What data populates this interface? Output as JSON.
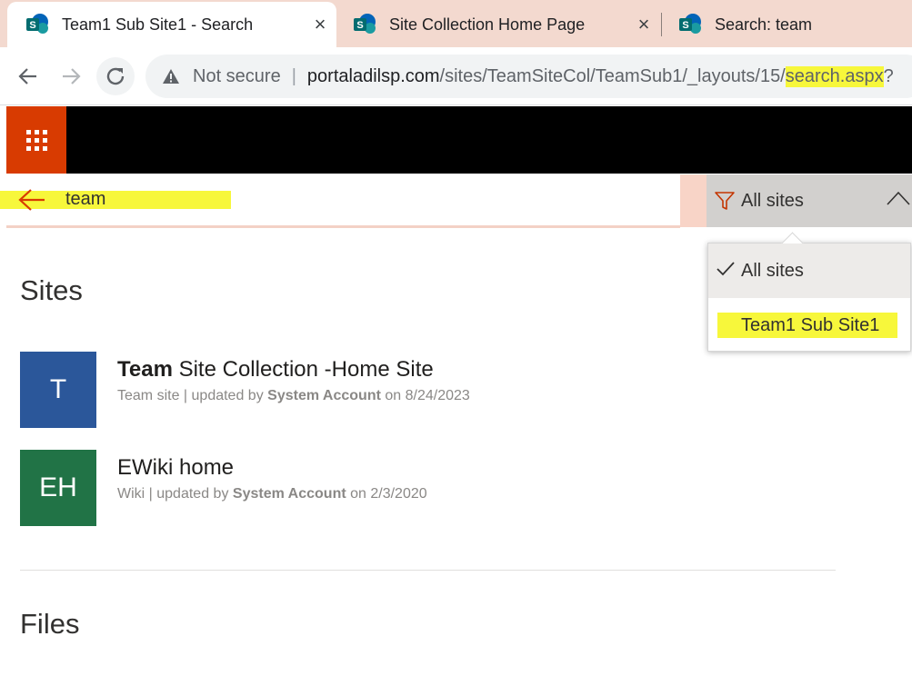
{
  "browser": {
    "tabs": [
      {
        "title": "Team1 Sub Site1 - Search",
        "close_icon": "×",
        "active": true
      },
      {
        "title": "Site Collection Home Page",
        "close_icon": "×",
        "active": false
      },
      {
        "title": "Search: team",
        "active": false
      }
    ],
    "address": {
      "security_label": "Not secure",
      "separator": "|",
      "host": "portaladilsp.com",
      "path": "/sites/TeamSiteCol/TeamSub1/_layouts/15/",
      "highlighted_path": "search.aspx",
      "trailing": "?"
    }
  },
  "search": {
    "query": "team",
    "scope_label": "All sites",
    "scope_options": [
      {
        "label": "All sites",
        "selected": true
      },
      {
        "label": "Team1 Sub Site1",
        "selected": false
      }
    ]
  },
  "sections": {
    "sites_title": "Sites",
    "files_title": "Files"
  },
  "results": [
    {
      "initials": "T",
      "tile_color": "#2b579a",
      "title_bold": "Team",
      "title_rest": " Site Collection -Home Site",
      "meta_prefix": "Team site | updated by ",
      "meta_author": "System Account",
      "meta_suffix": " on 8/24/2023"
    },
    {
      "initials": "EH",
      "tile_color": "#217346",
      "title_bold": "",
      "title_rest": "EWiki home",
      "meta_prefix": "Wiki | updated by ",
      "meta_author": "System Account",
      "meta_suffix": " on 2/3/2020"
    }
  ],
  "colors": {
    "waffle": "#d83b01",
    "suitebar": "#000000",
    "highlight": "#f7f73b",
    "scope_button": "#d2d0ce"
  }
}
